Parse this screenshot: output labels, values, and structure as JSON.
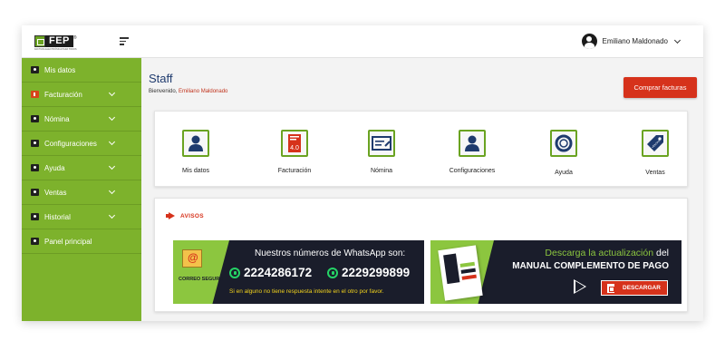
{
  "brand": {
    "logo_text": "FEP",
    "logo_reg": "®",
    "logo_tagline": "FACTURA ELECTRÓNICA PARA TODOS"
  },
  "sidebar": {
    "items": [
      {
        "label": "Mis datos",
        "icon": "user-card-icon",
        "has_submenu": false
      },
      {
        "label": "Facturación",
        "icon": "invoice-icon",
        "has_submenu": true
      },
      {
        "label": "Nómina",
        "icon": "payroll-icon",
        "has_submenu": true
      },
      {
        "label": "Configuraciones",
        "icon": "gear-icon",
        "has_submenu": true
      },
      {
        "label": "Ayuda",
        "icon": "help-icon",
        "has_submenu": true
      },
      {
        "label": "Ventas",
        "icon": "tag-icon",
        "has_submenu": true
      },
      {
        "label": "Historial",
        "icon": "history-icon",
        "has_submenu": true
      },
      {
        "label": "Panel principal",
        "icon": "dashboard-icon",
        "has_submenu": false
      }
    ]
  },
  "header": {
    "user_name": "Emiliano Maldonado"
  },
  "main": {
    "title": "Staff",
    "welcome_prefix": "Bienvenido, ",
    "welcome_user": "Emiliano Maldonado",
    "buy_button": "Comprar facturas",
    "quick_access": [
      {
        "label": "Mis datos",
        "icon": "user-icon"
      },
      {
        "label": "Facturación",
        "icon": "invoice-4-0-icon",
        "badge": "4.0"
      },
      {
        "label": "Nómina",
        "icon": "payroll-icon"
      },
      {
        "label": "Configuraciones",
        "icon": "user-settings-icon"
      },
      {
        "label": "Ayuda",
        "icon": "lifebuoy-icon"
      },
      {
        "label": "Ventas",
        "icon": "price-tag-icon",
        "badge": "VENTAS"
      }
    ],
    "avisos": {
      "title": "AVISOS",
      "whatsapp_banner": {
        "badge": "CORREO SEGURO",
        "title": "Nuestros números de WhatsApp son:",
        "number_1": "2224286172",
        "number_2": "2229299899",
        "note": "Si en alguno no tiene respuesta intente en el otro por favor."
      },
      "download_banner": {
        "line1_highlight": "Descarga la actualización",
        "line1_rest": " del",
        "line2": "MANUAL COMPLEMENTO DE PAGO",
        "button": "DESCARGAR"
      }
    }
  },
  "colors": {
    "sidebar": "#7db22c",
    "accent_red": "#d6321b",
    "title_blue": "#1f3b6e",
    "banner_dark": "#1a1d2b"
  }
}
